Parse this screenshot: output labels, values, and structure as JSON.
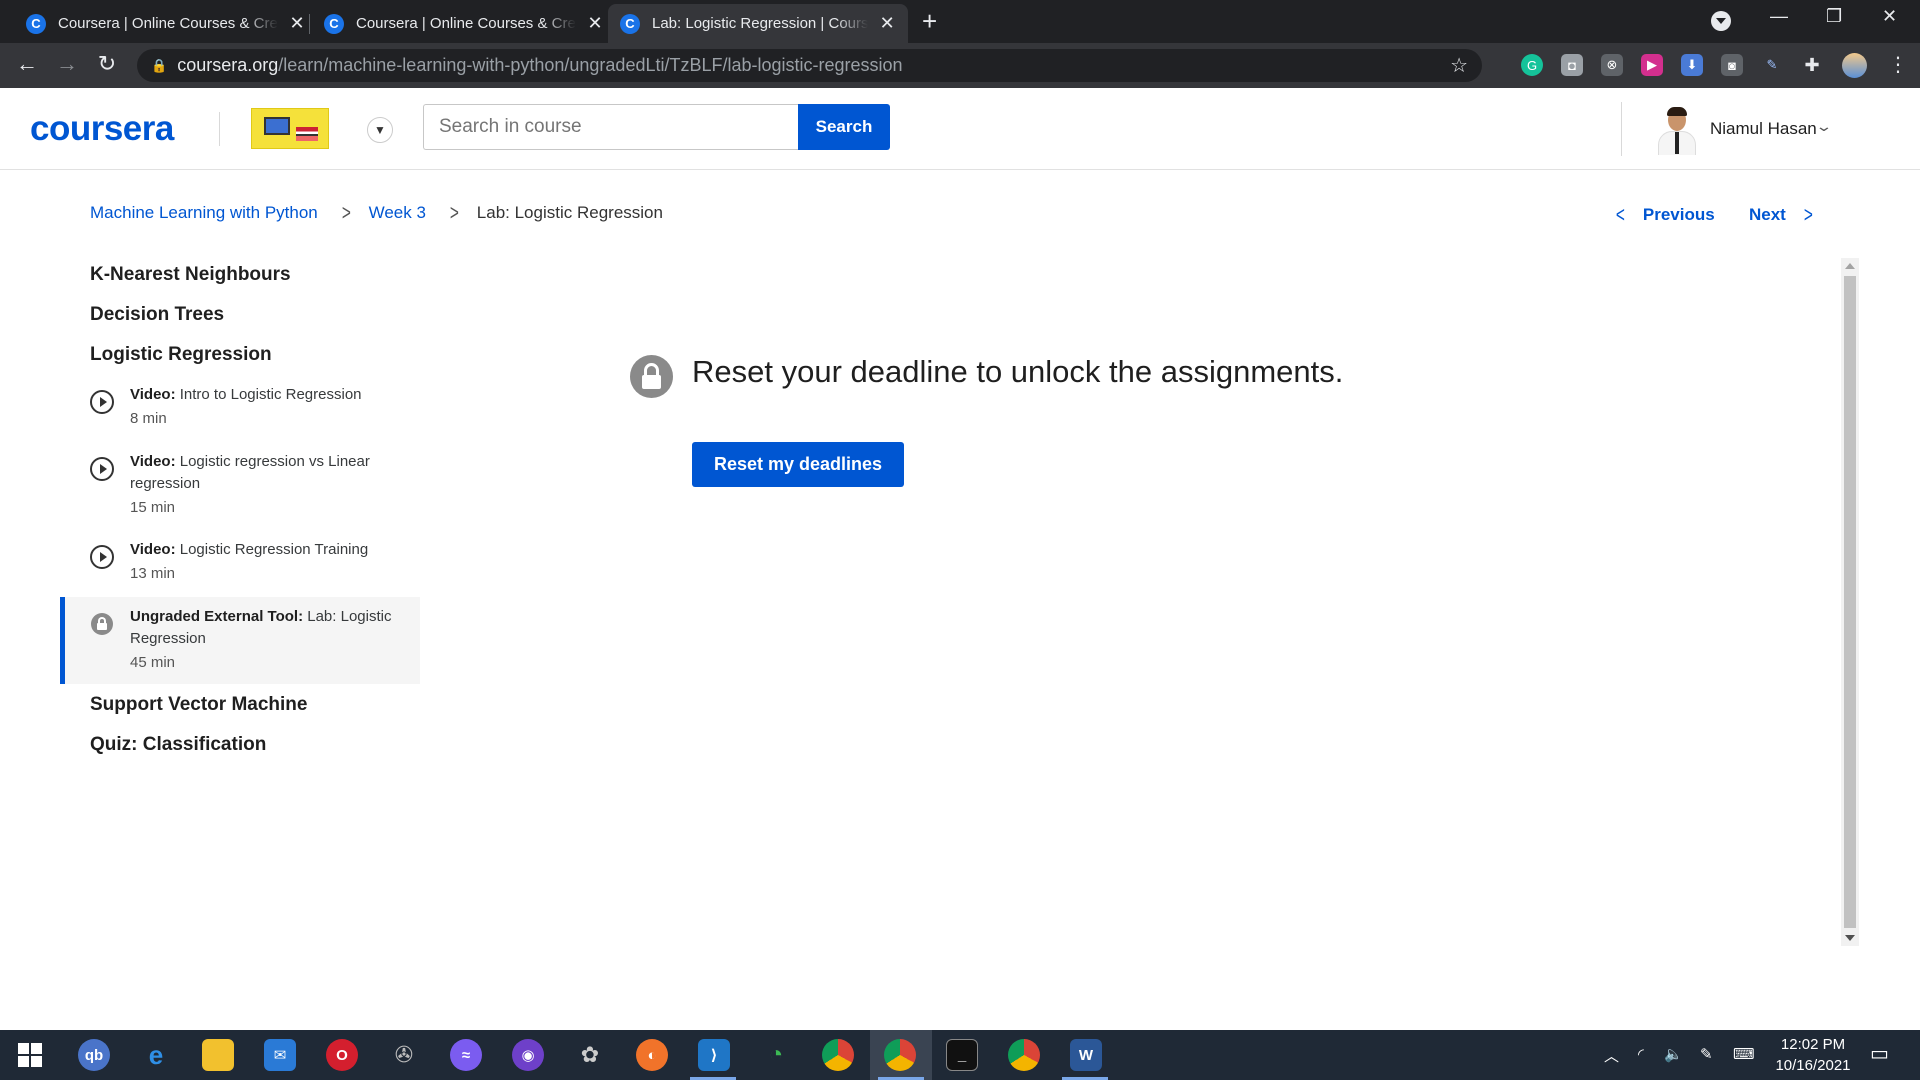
{
  "browser": {
    "tabs": [
      {
        "title": "Coursera | Online Courses & Credentials",
        "active": false
      },
      {
        "title": "Coursera | Online Courses & Credentials",
        "active": false
      },
      {
        "title": "Lab: Logistic Regression | Coursera",
        "active": true
      }
    ],
    "url_host": "coursera.org",
    "url_path": "/learn/machine-learning-with-python/ungradedLti/TzBLF/lab-logistic-regression"
  },
  "header": {
    "logo": "coursera",
    "search_placeholder": "Search in course",
    "search_button": "Search",
    "user_name": "Niamul Hasan"
  },
  "breadcrumb": {
    "course": "Machine Learning with Python",
    "week": "Week 3",
    "current": "Lab: Logistic Regression"
  },
  "nav": {
    "previous": "Previous",
    "next": "Next"
  },
  "sidebar": {
    "lessons": [
      "K-Nearest Neighbours",
      "Decision Trees",
      "Logistic Regression",
      "Support Vector Machine",
      "Quiz: Classification"
    ],
    "items": [
      {
        "kind": "Video:",
        "title": "Intro to Logistic Regression",
        "duration": "8 min"
      },
      {
        "kind": "Video:",
        "title": "Logistic regression vs Linear regression",
        "duration": "15 min"
      },
      {
        "kind": "Video:",
        "title": "Logistic Regression Training",
        "duration": "13 min"
      },
      {
        "kind": "Ungraded External Tool:",
        "title": "Lab: Logistic Regression",
        "duration": "45 min"
      }
    ]
  },
  "main": {
    "message": "Reset your deadline to unlock the assignments.",
    "button": "Reset my deadlines"
  },
  "taskbar": {
    "time": "12:02 PM",
    "date": "10/16/2021"
  },
  "colors": {
    "brand": "#0056d2"
  }
}
